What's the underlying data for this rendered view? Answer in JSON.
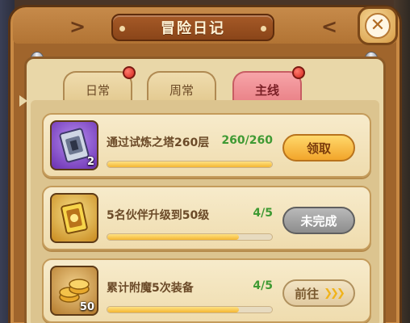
{
  "header": {
    "title": "冒险日记",
    "left_chevron": ">",
    "right_chevron": "<",
    "close_icon": "close-icon"
  },
  "tabs": [
    {
      "label": "日常",
      "has_alert": true,
      "active": false
    },
    {
      "label": "周常",
      "has_alert": false,
      "active": false
    },
    {
      "label": "主线",
      "has_alert": true,
      "active": true
    }
  ],
  "quests": [
    {
      "name": "通过试炼之塔260层",
      "progress_label": "260/260",
      "progress": 1.0,
      "icon": "tower-card-icon",
      "icon_count": "2",
      "button_label": "领取",
      "button_state": "claim"
    },
    {
      "name": "5名伙伴升级到50级",
      "progress_label": "4/5",
      "progress": 0.8,
      "icon": "gold-card-icon",
      "icon_count": "",
      "button_label": "未完成",
      "button_state": "incomplete"
    },
    {
      "name": "累计附魔5次装备",
      "progress_label": "4/5",
      "progress": 0.8,
      "icon": "gold-coins-icon",
      "icon_count": "50",
      "button_label": "前往",
      "button_state": "goto"
    }
  ],
  "colors": {
    "progress_text": "#3f9a33",
    "active_tab": "#e98086",
    "claim_button": "#f2a52b",
    "incomplete_button": "#8d8d8d"
  }
}
